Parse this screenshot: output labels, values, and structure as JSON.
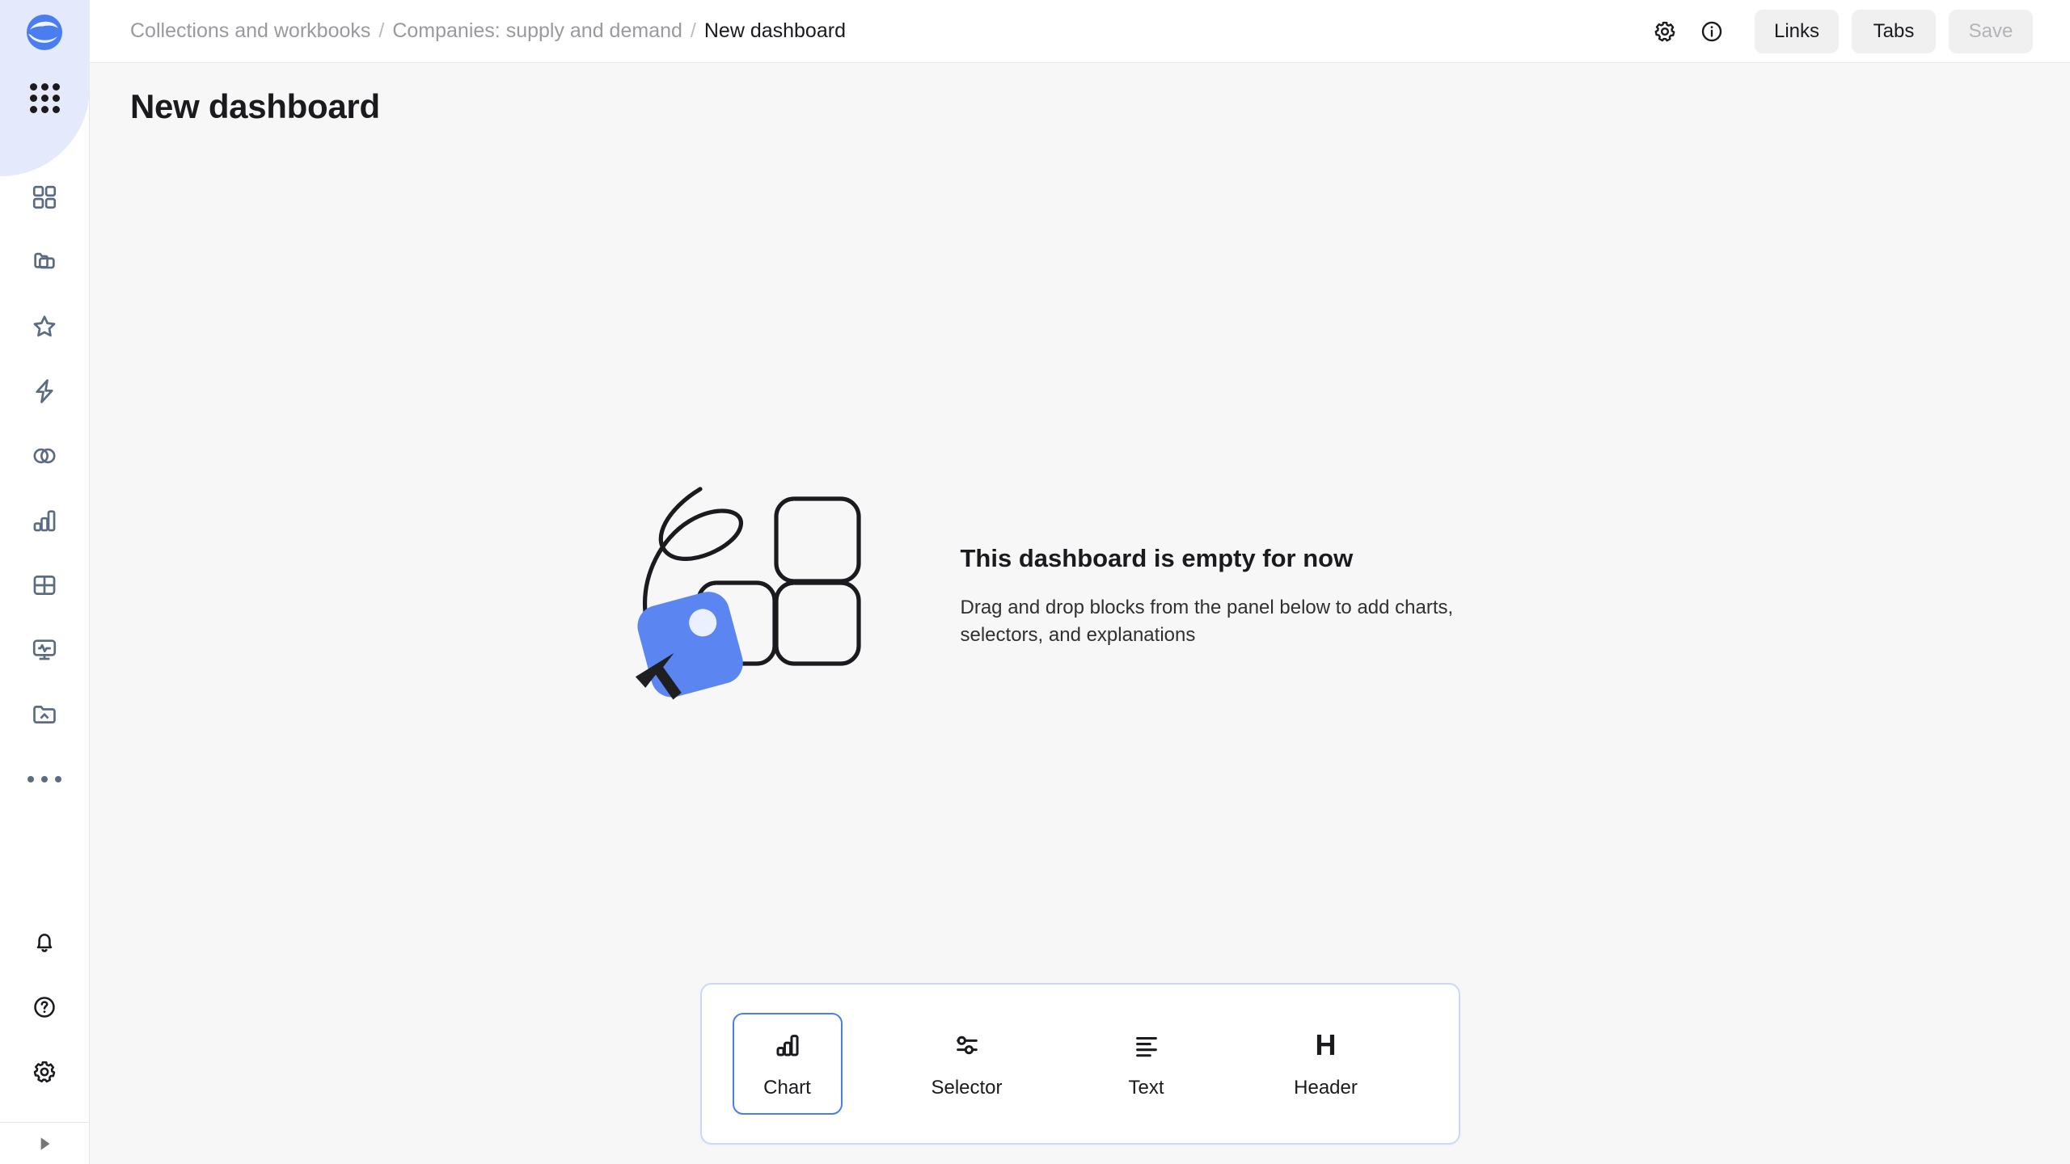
{
  "app": {
    "logo_icon": "datalens-logo",
    "accent_color": "#4a7ef0",
    "highlight_color": "#e4e9fb"
  },
  "sidebar": {
    "apps_icon": "apps-grid-icon",
    "items": [
      {
        "icon": "dashboard-squares-icon",
        "name": "sidebar-item-dashboards"
      },
      {
        "icon": "folders-icon",
        "name": "sidebar-item-collections"
      },
      {
        "icon": "star-icon",
        "name": "sidebar-item-favorites"
      },
      {
        "icon": "lightning-icon",
        "name": "sidebar-item-quickstart"
      },
      {
        "icon": "overlapping-circles-icon",
        "name": "sidebar-item-datasets"
      },
      {
        "icon": "bar-chart-icon",
        "name": "sidebar-item-charts"
      },
      {
        "icon": "table-grid-icon",
        "name": "sidebar-item-tables"
      },
      {
        "icon": "monitor-pulse-icon",
        "name": "sidebar-item-monitoring"
      },
      {
        "icon": "folder-cloud-icon",
        "name": "sidebar-item-connections"
      },
      {
        "icon": "ellipsis-icon",
        "name": "sidebar-item-more"
      }
    ],
    "bottom_items": [
      {
        "icon": "bell-icon",
        "name": "sidebar-item-notifications"
      },
      {
        "icon": "question-circle-icon",
        "name": "sidebar-item-help"
      },
      {
        "icon": "gear-icon",
        "name": "sidebar-item-settings"
      }
    ],
    "footer": {
      "icon": "collapse-expand-arrow-icon",
      "name": "sidebar-collapse-toggle"
    }
  },
  "topbar": {
    "breadcrumb": {
      "items": [
        {
          "label": "Collections and workbooks",
          "current": false
        },
        {
          "label": "Companies: supply and demand",
          "current": false
        },
        {
          "label": "New dashboard",
          "current": true
        }
      ],
      "separator": "/"
    },
    "settings_icon": "gear-icon",
    "info_icon": "info-circle-icon",
    "links_label": "Links",
    "tabs_label": "Tabs",
    "save_label": "Save",
    "save_disabled": true
  },
  "page": {
    "title": "New dashboard"
  },
  "empty_state": {
    "illustration": "drag-drop-blocks-illustration",
    "title": "This dashboard is empty for now",
    "subtitle": "Drag and drop blocks from the panel below to add charts, selectors, and explanations"
  },
  "palette": {
    "items": [
      {
        "label": "Chart",
        "icon": "bar-chart-icon",
        "selected": true
      },
      {
        "label": "Selector",
        "icon": "sliders-icon",
        "selected": false
      },
      {
        "label": "Text",
        "icon": "text-lines-icon",
        "selected": false
      },
      {
        "label": "Header",
        "icon": "header-h-icon",
        "selected": false
      }
    ]
  }
}
